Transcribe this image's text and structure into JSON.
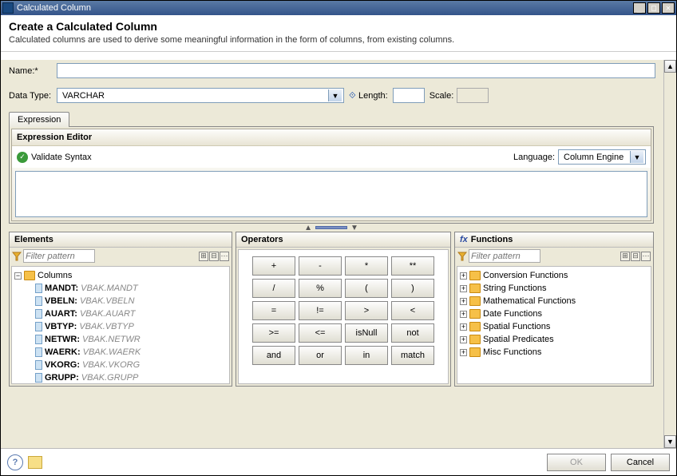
{
  "titlebar": {
    "title": "Calculated Column"
  },
  "header": {
    "heading": "Create a Calculated Column",
    "description": "Calculated columns are used to derive some meaningful information in the form of columns, from existing columns."
  },
  "form": {
    "name_label": "Name:*",
    "name_value": "",
    "datatype_label": "Data Type:",
    "datatype_value": "VARCHAR",
    "length_label": "Length:",
    "length_value": "",
    "scale_label": "Scale:",
    "scale_value": ""
  },
  "tabs": {
    "expression": "Expression"
  },
  "expression_editor": {
    "title": "Expression Editor",
    "validate_label": "Validate Syntax",
    "language_label": "Language:",
    "language_value": "Column Engine",
    "expression_value": ""
  },
  "elements": {
    "title": "Elements",
    "filter_placeholder": "Filter pattern",
    "root": "Columns",
    "columns": [
      {
        "name": "MANDT",
        "src": "VBAK.MANDT"
      },
      {
        "name": "VBELN",
        "src": "VBAK.VBELN"
      },
      {
        "name": "AUART",
        "src": "VBAK.AUART"
      },
      {
        "name": "VBTYP",
        "src": "VBAK.VBTYP"
      },
      {
        "name": "NETWR",
        "src": "VBAK.NETWR"
      },
      {
        "name": "WAERK",
        "src": "VBAK.WAERK"
      },
      {
        "name": "VKORG",
        "src": "VBAK.VKORG"
      },
      {
        "name": "GRUPP",
        "src": "VBAK.GRUPP"
      }
    ]
  },
  "operators": {
    "title": "Operators",
    "buttons": [
      "+",
      "-",
      "*",
      "**",
      "/",
      "%",
      "(",
      ")",
      "=",
      "!=",
      ">",
      "<",
      ">=",
      "<=",
      "isNull",
      "not",
      "and",
      "or",
      "in",
      "match"
    ]
  },
  "functions": {
    "title": "Functions",
    "fx_prefix": "fx",
    "filter_placeholder": "Filter pattern",
    "categories": [
      "Conversion Functions",
      "String Functions",
      "Mathematical Functions",
      "Date Functions",
      "Spatial Functions",
      "Spatial Predicates",
      "Misc Functions"
    ]
  },
  "footer": {
    "ok": "OK",
    "cancel": "Cancel"
  }
}
